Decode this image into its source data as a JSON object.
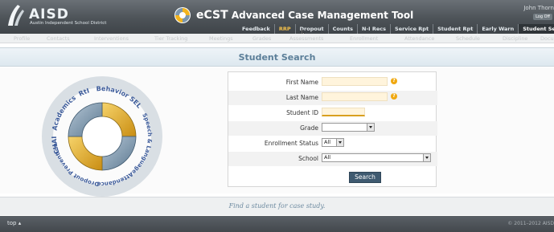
{
  "header": {
    "logo_text": "AISD",
    "logo_subtitle": "Austin Independent School District",
    "app_brand": "eCST",
    "app_title": "Advanced Case Management Tool",
    "user_name": "John Thorn",
    "logoff_label": "Log Off"
  },
  "top_nav": {
    "items": [
      {
        "label": "Feedback"
      },
      {
        "label": "RRP"
      },
      {
        "label": "Dropout"
      },
      {
        "label": "Counts"
      },
      {
        "label": "N-I Recs"
      },
      {
        "label": "Service Rpt"
      },
      {
        "label": "Student Rpt"
      },
      {
        "label": "Early Warn"
      },
      {
        "label": "Student Search"
      }
    ],
    "active": "RRP"
  },
  "sub_nav": {
    "items": [
      {
        "label": "Profile"
      },
      {
        "label": "Contacts"
      },
      {
        "label": "Interventions"
      },
      {
        "label": "Tier Tracking"
      },
      {
        "label": "Meetings"
      },
      {
        "label": "Grades"
      },
      {
        "label": "Assessments"
      },
      {
        "label": "Enrollment"
      },
      {
        "label": "Attendance"
      },
      {
        "label": "Schedule"
      },
      {
        "label": "Discipline"
      },
      {
        "label": "Docu"
      }
    ]
  },
  "page_title": "Student Search",
  "cycle_graphic": {
    "labels": [
      "Academics",
      "RtI",
      "Behavior",
      "SEL",
      "Speech & Language",
      "Attendance",
      "Dropout Prevention",
      "CHAI"
    ]
  },
  "form": {
    "first_name": {
      "label": "First Name",
      "value": ""
    },
    "last_name": {
      "label": "Last Name",
      "value": ""
    },
    "student_id": {
      "label": "Student ID",
      "value": ""
    },
    "grade": {
      "label": "Grade",
      "value": ""
    },
    "enrollment_status": {
      "label": "Enrollment Status",
      "value": "All"
    },
    "school": {
      "label": "School",
      "value": "All"
    },
    "search_label": "Search",
    "required_icon": "?"
  },
  "footer": {
    "caption": "Find a student for case study.",
    "top_link": "top",
    "copyright": "© 2011–2012 AISD"
  },
  "colors": {
    "header_bg": "#4d5358",
    "active_nav": "#f4c14a",
    "title_text": "#5c7f99",
    "field_bg": "#fff4dc",
    "button_bg": "#3f5a70",
    "warning": "#f0a810"
  }
}
